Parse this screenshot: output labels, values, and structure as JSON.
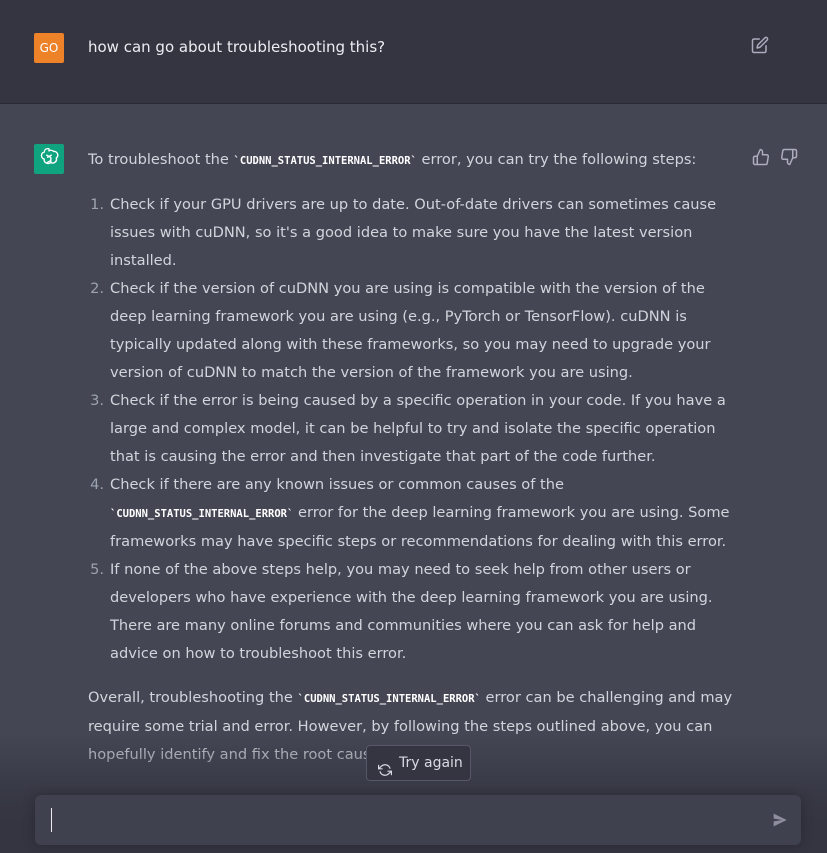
{
  "user_message": {
    "avatar_initials": "GO",
    "text": "how can go about troubleshooting this?",
    "avatar_color": "#ee8229",
    "edit_icon": "edit-icon"
  },
  "assistant_message": {
    "avatar_icon": "openai-logo-icon",
    "avatar_color": "#10a37f",
    "intro_before": "To troubleshoot the ",
    "intro_code": "`CUDNN_STATUS_INTERNAL_ERROR`",
    "intro_after": " error, you can try the following steps:",
    "steps": [
      {
        "number": "1.",
        "text": "Check if your GPU drivers are up to date. Out-of-date drivers can sometimes cause issues with cuDNN, so it's a good idea to make sure you have the latest version installed."
      },
      {
        "number": "2.",
        "text": "Check if the version of cuDNN you are using is compatible with the version of the deep learning framework you are using (e.g., PyTorch or TensorFlow). cuDNN is typically updated along with these frameworks, so you may need to upgrade your version of cuDNN to match the version of the framework you are using."
      },
      {
        "number": "3.",
        "text": "Check if the error is being caused by a specific operation in your code. If you have a large and complex model, it can be helpful to try and isolate the specific operation that is causing the error and then investigate that part of the code further."
      },
      {
        "number": "4.",
        "text_before": "Check if there are any known issues or common causes of the ",
        "code": "`CUDNN_STATUS_INTERNAL_ERROR`",
        "text_after": " error for the deep learning framework you are using. Some frameworks may have specific steps or recommendations for dealing with this error."
      },
      {
        "number": "5.",
        "text": "If none of the above steps help, you may need to seek help from other users or developers who have experience with the deep learning framework you are using. There are many online forums and communities where you can ask for help and advice on how to troubleshoot this error."
      }
    ],
    "outro_before": "Overall, troubleshooting the ",
    "outro_code": "`CUDNN_STATUS_INTERNAL_ERROR`",
    "outro_after": " error can be challenging and may require some trial and error. However, by following the steps outlined above, you can hopefully identify and fix the root cause of the error.",
    "feedback_icons": [
      "thumbs-up-icon",
      "thumbs-down-icon"
    ]
  },
  "try_again": {
    "label": "Try again",
    "icon": "refresh-icon"
  },
  "composer": {
    "value": "",
    "send_icon": "send-icon"
  },
  "colors": {
    "page_bg": "#444654",
    "user_row_bg": "#343541",
    "composer_bg": "#40414f",
    "text": "#d1d5db"
  }
}
